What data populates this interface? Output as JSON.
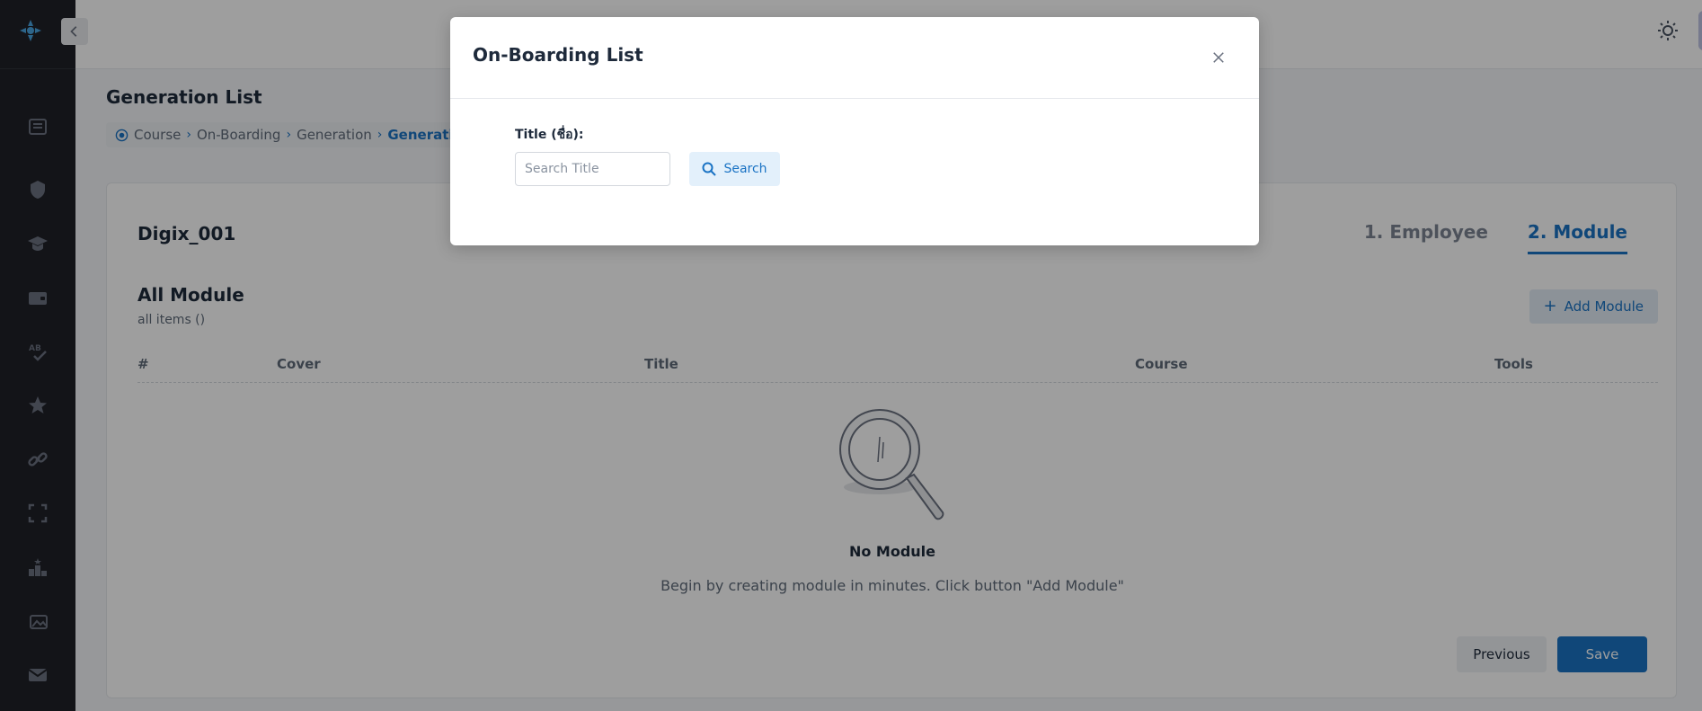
{
  "modal": {
    "title": "On-Boarding List",
    "field_label": "Title (ชื่อ):",
    "search_placeholder": "Search Title",
    "search_button": "Search"
  },
  "page": {
    "title": "Generation List",
    "breadcrumb": [
      "Course",
      "On-Boarding",
      "Generation",
      "Generation"
    ]
  },
  "card": {
    "generation_name": "Digix_001",
    "steps": [
      {
        "label": "1. Employee",
        "active": false
      },
      {
        "label": "2. Module",
        "active": true
      }
    ],
    "section_title": "All Module",
    "section_subtitle": "all items ()",
    "add_button": "Add Module",
    "table_headers": [
      "#",
      "Cover",
      "Title",
      "Course",
      "Tools"
    ],
    "empty_title": "No Module",
    "empty_description": "Begin by creating module in minutes. Click button \"Add Module\"",
    "previous_button": "Previous",
    "save_button": "Save"
  },
  "sidebar": {
    "icons": [
      "book-icon",
      "shield-icon",
      "graduation-cap-icon",
      "wallet-icon",
      "spell-check-icon",
      "star-icon",
      "link-icon",
      "expand-icon",
      "podium-icon",
      "image-icon",
      "mail-icon"
    ]
  },
  "colors": {
    "accent": "#1a73c4",
    "sidebar_bg": "#1f2128",
    "accent_light": "#e3f0fb"
  }
}
